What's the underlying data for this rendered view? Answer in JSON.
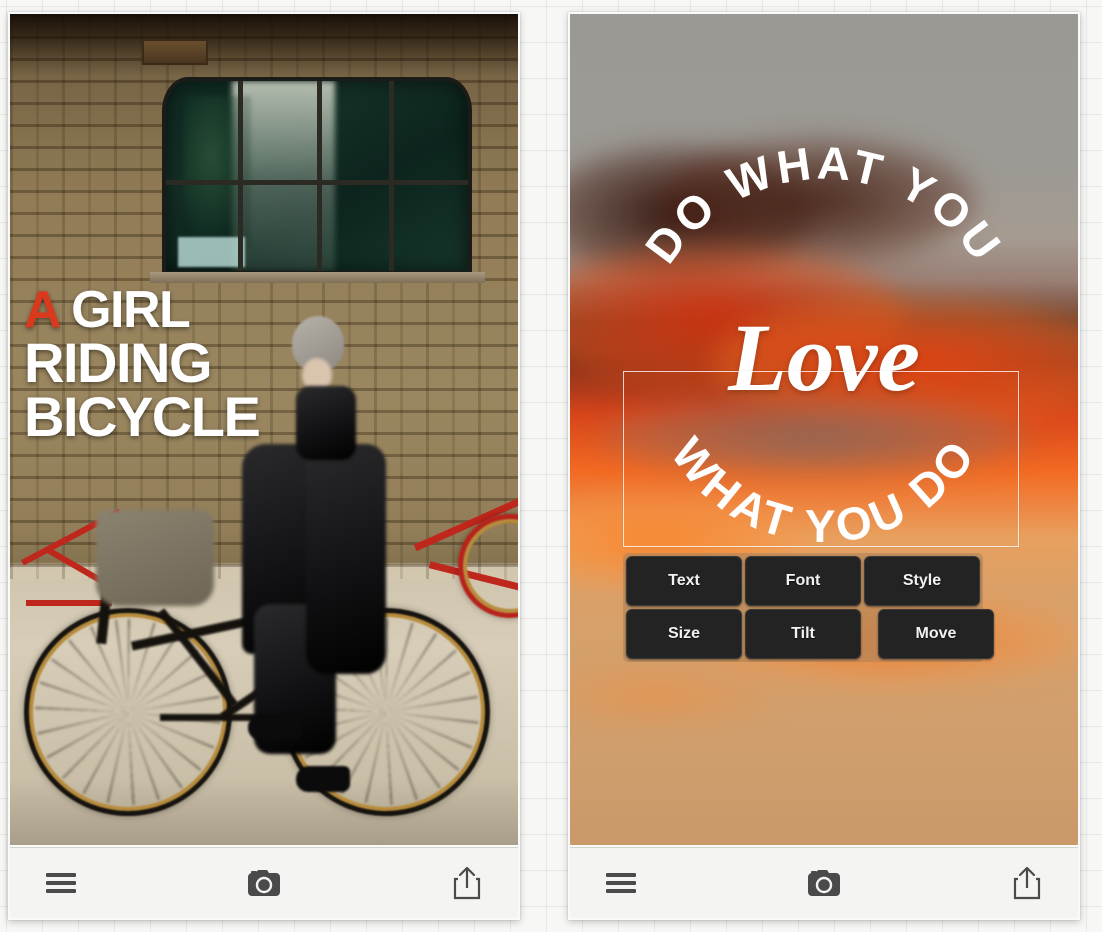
{
  "app": {
    "background_color": "#f7f7f5",
    "grid_color": "#969696"
  },
  "cards": [
    {
      "name": "bicycle-poster-card",
      "photo": {
        "subject": "woman riding bicycle past brick wall with arched industrial window",
        "dominant_colors": [
          "#8a7550",
          "#cfc4ad",
          "#143027"
        ]
      },
      "overlay_text": {
        "line1_accent": "A",
        "line1_rest": " GIRL",
        "line2": "RIDING",
        "line3": "BICYCLE",
        "accent_color": "#d93a1e",
        "text_color": "#ffffff"
      }
    },
    {
      "name": "sunset-quote-card",
      "photo": {
        "subject": "orange and red sunset clouds over grey sky",
        "dominant_colors": [
          "#9b9994",
          "#d5441a",
          "#d3a06d"
        ]
      },
      "badge": {
        "top_arc": "DO WHAT YOU",
        "script_word": "Love",
        "bottom_arc": "WHAT YOU DO",
        "text_color": "#ffffff"
      },
      "selection_box": {
        "visible": true,
        "stroke_color": "#ffffff"
      },
      "editor_pad": {
        "frame_color": "#ac845a",
        "button_color": "#232323",
        "buttons": [
          {
            "label": "Text"
          },
          {
            "label": "Font"
          },
          {
            "label": "Style"
          },
          {
            "label": "Size"
          },
          {
            "label": "Tilt"
          },
          {
            "label": "Move"
          }
        ]
      }
    }
  ],
  "toolbar": {
    "menu_icon": "hamburger-menu-icon",
    "camera_icon": "camera-icon",
    "share_icon": "share-icon",
    "icon_color": "#4a4a4a"
  }
}
